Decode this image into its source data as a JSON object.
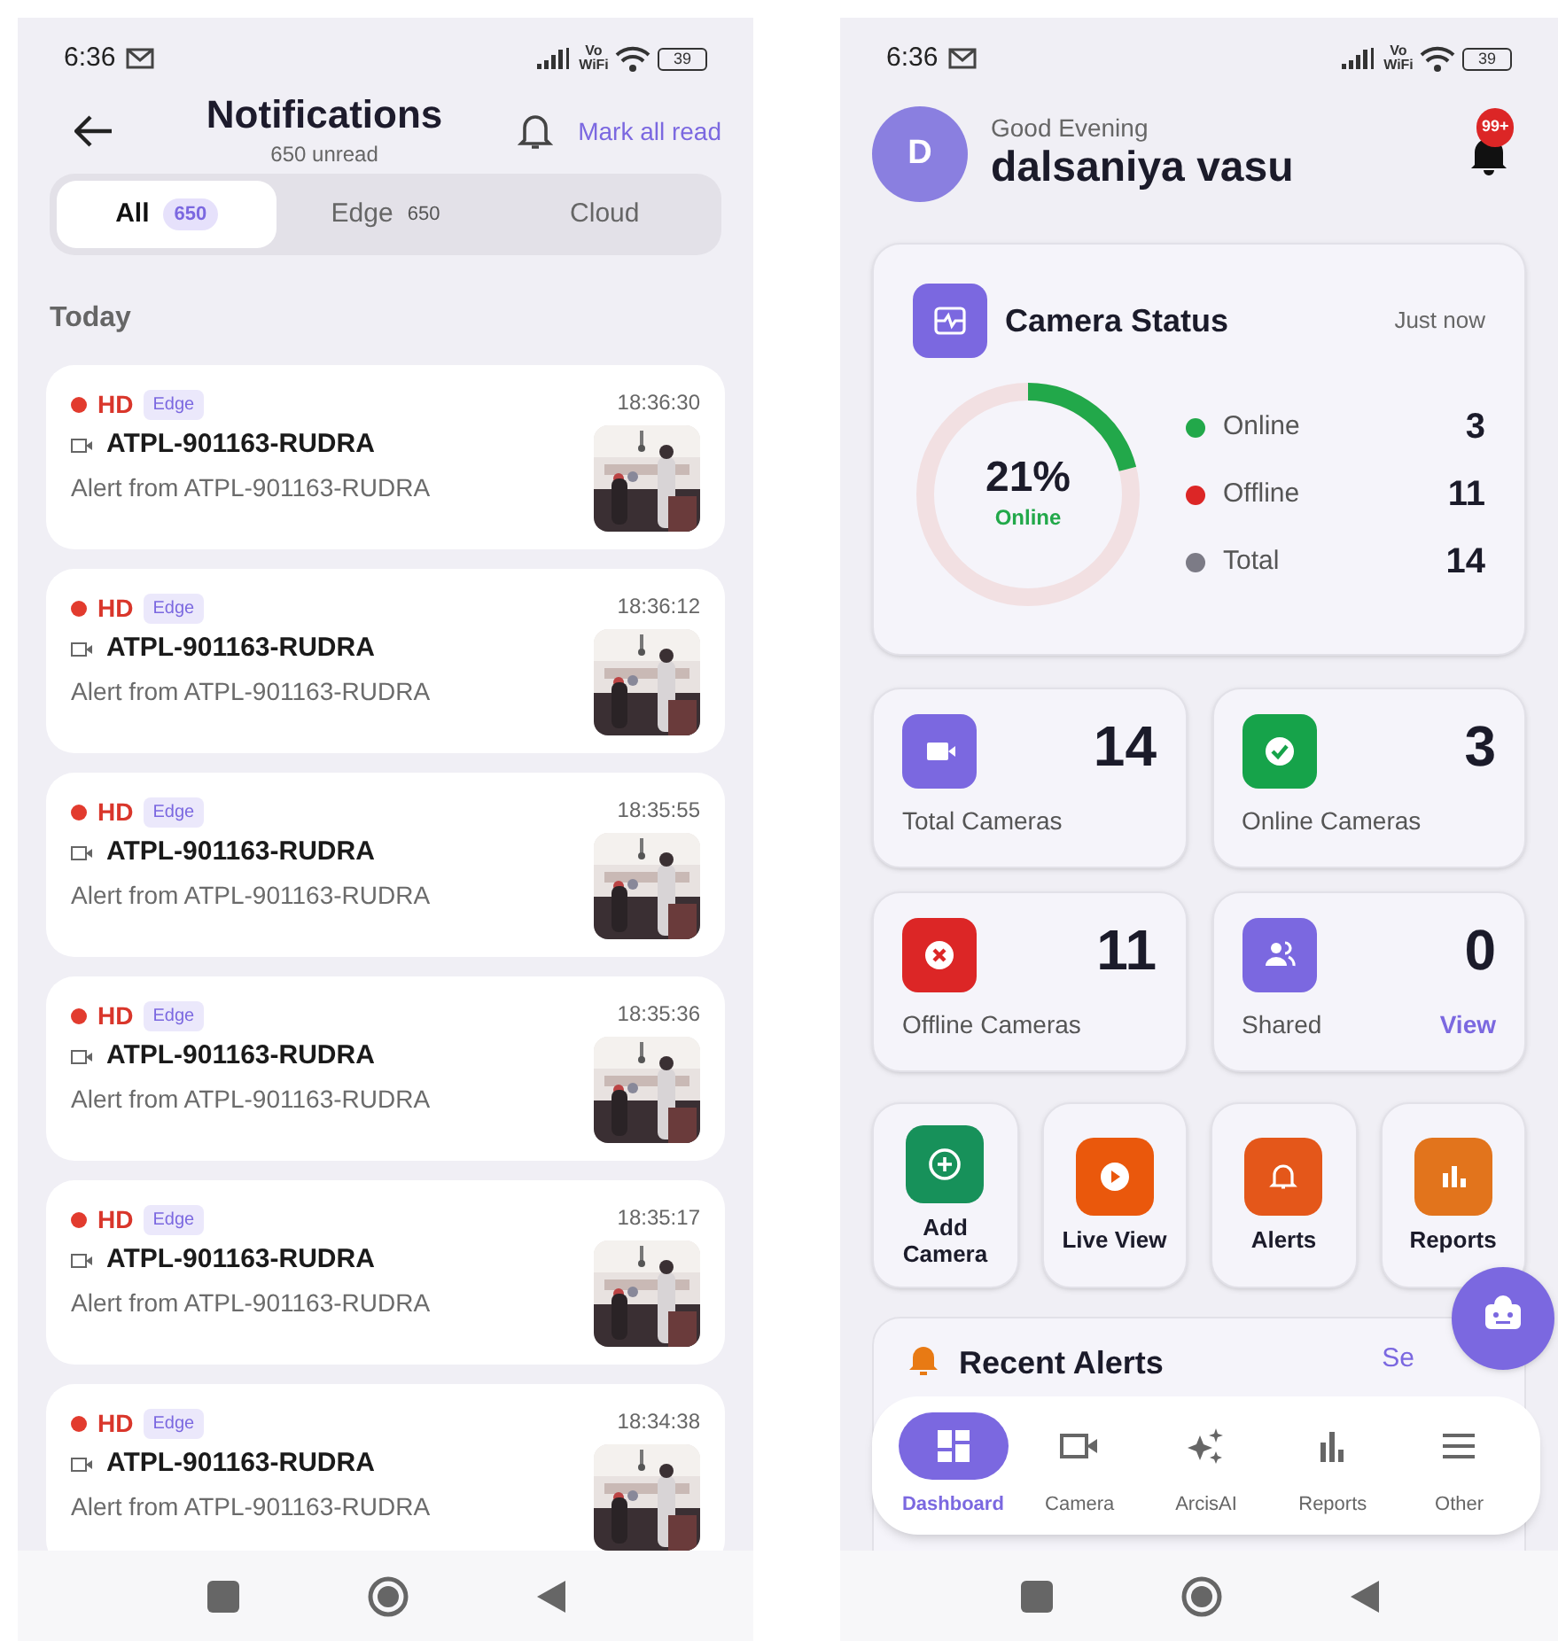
{
  "notifications_screen": {
    "status_bar": {
      "time": "6:36",
      "network_label": "Vo WiFi",
      "battery": "39"
    },
    "header": {
      "title": "Notifications",
      "subtitle": "650 unread",
      "action": "Mark all read"
    },
    "tabs": [
      {
        "label": "All",
        "count": "650",
        "selected": true
      },
      {
        "label": "Edge",
        "count": "650",
        "selected": false
      },
      {
        "label": "Cloud",
        "selected": false
      }
    ],
    "section": "Today",
    "notifications": [
      {
        "quality": "HD",
        "source": "Edge",
        "time": "18:36:30",
        "camera": "ATPL-901163-RUDRA",
        "message": "Alert from ATPL-901163-RUDRA"
      },
      {
        "quality": "HD",
        "source": "Edge",
        "time": "18:36:12",
        "camera": "ATPL-901163-RUDRA",
        "message": "Alert from ATPL-901163-RUDRA"
      },
      {
        "quality": "HD",
        "source": "Edge",
        "time": "18:35:55",
        "camera": "ATPL-901163-RUDRA",
        "message": "Alert from ATPL-901163-RUDRA"
      },
      {
        "quality": "HD",
        "source": "Edge",
        "time": "18:35:36",
        "camera": "ATPL-901163-RUDRA",
        "message": "Alert from ATPL-901163-RUDRA"
      },
      {
        "quality": "HD",
        "source": "Edge",
        "time": "18:35:17",
        "camera": "ATPL-901163-RUDRA",
        "message": "Alert from ATPL-901163-RUDRA"
      },
      {
        "quality": "HD",
        "source": "Edge",
        "time": "18:34:38",
        "camera": "ATPL-901163-RUDRA",
        "message": "Alert from ATPL-901163-RUDRA"
      }
    ]
  },
  "dashboard_screen": {
    "status_bar": {
      "time": "6:36",
      "network_label": "Vo WiFi",
      "battery": "39"
    },
    "greeting": "Good Evening",
    "user_name": "dalsaniya vasu",
    "avatar_initial": "D",
    "notification_badge": "99+",
    "camera_status": {
      "title": "Camera Status",
      "updated": "Just now",
      "percent": "21%",
      "percent_label": "Online",
      "level": 0.21,
      "legend": [
        {
          "label": "Online",
          "value": "3",
          "color": "#22a84a"
        },
        {
          "label": "Offline",
          "value": "11",
          "color": "#dc2626"
        },
        {
          "label": "Total",
          "value": "14",
          "color": "#7c7b86"
        }
      ]
    },
    "stat_cards": [
      {
        "kind": "camera",
        "value": "14",
        "label": "Total Cameras",
        "color": "#7b68e0"
      },
      {
        "kind": "check",
        "value": "3",
        "label": "Online Cameras",
        "color": "#16a34a"
      },
      {
        "kind": "cross",
        "value": "11",
        "label": "Offline Cameras",
        "color": "#dc2626"
      },
      {
        "kind": "people",
        "value": "0",
        "label": "Shared",
        "link": "View",
        "color": "#7b68e0"
      }
    ],
    "quick_actions": [
      {
        "kind": "add",
        "label": "Add Camera",
        "color": "#17915a"
      },
      {
        "kind": "play",
        "label": "Live View",
        "color": "#ea580c"
      },
      {
        "kind": "bell",
        "label": "Alerts",
        "color": "#e4571a"
      },
      {
        "kind": "chart",
        "label": "Reports",
        "color": "#e2741c"
      }
    ],
    "recent_alerts": {
      "title": "Recent Alerts",
      "link": "Se"
    },
    "bottom_nav": [
      {
        "kind": "grid",
        "label": "Dashboard",
        "selected": true
      },
      {
        "kind": "camera",
        "label": "Camera",
        "selected": false
      },
      {
        "kind": "sparkle",
        "label": "ArcisAI",
        "selected": false
      },
      {
        "kind": "chart",
        "label": "Reports",
        "selected": false
      },
      {
        "kind": "menu",
        "label": "Other",
        "selected": false
      }
    ]
  }
}
